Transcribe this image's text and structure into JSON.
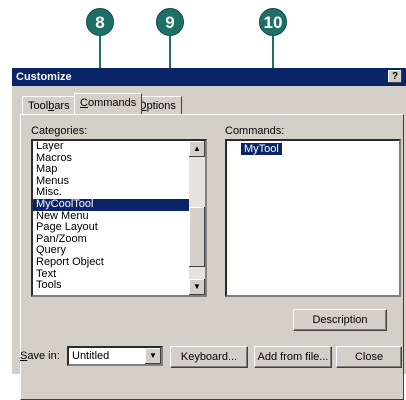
{
  "callouts": [
    "8",
    "9",
    "10"
  ],
  "dialog": {
    "title": "Customize",
    "help": "?"
  },
  "tabs": [
    "Toolbars",
    "Commands",
    "Options"
  ],
  "categories": {
    "label": "Categories:",
    "items": [
      "Layer",
      "Macros",
      "Map",
      "Menus",
      "Misc.",
      "MyCoolTool",
      "New Menu",
      "Page Layout",
      "Pan/Zoom",
      "Query",
      "Report Object",
      "Text",
      "Tools"
    ],
    "selected": "MyCoolTool"
  },
  "commands": {
    "label": "Commands:",
    "items": [
      "MyTool"
    ],
    "selected": "MyTool"
  },
  "description_button": "Description",
  "save_in": {
    "label": "Save in:",
    "value": "Untitled"
  },
  "buttons": {
    "keyboard": "Keyboard...",
    "add_from_file": "Add from file...",
    "close": "Close"
  },
  "colors": {
    "callout": "#1f6f69",
    "titlebar": "#0a246a",
    "selection": "#0a246a",
    "dialog_bg": "#d4d0c8"
  }
}
